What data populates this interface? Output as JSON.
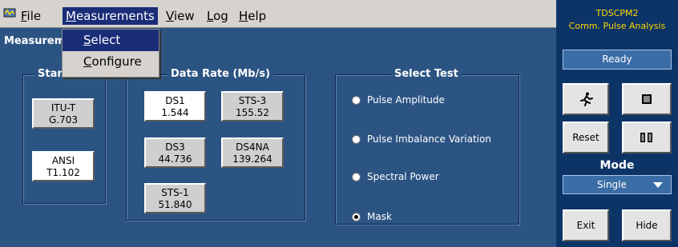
{
  "menubar": {
    "items": [
      {
        "label": "File",
        "key": "F"
      },
      {
        "label": "Measurements",
        "key": "M"
      },
      {
        "label": "View",
        "key": "V"
      },
      {
        "label": "Log",
        "key": "L"
      },
      {
        "label": "Help",
        "key": "H"
      }
    ],
    "dropdown": [
      "Select",
      "Configure"
    ]
  },
  "main": {
    "title": "Measurements",
    "standard_group": {
      "title": "Standard",
      "buttons": [
        {
          "line1": "ITU-T",
          "line2": "G.703"
        },
        {
          "line1": "ANSI",
          "line2": "T1.102"
        }
      ]
    },
    "datarate_group": {
      "title": "Data Rate (Mb/s)",
      "buttons": [
        {
          "line1": "DS1",
          "line2": "1.544"
        },
        {
          "line1": "STS-3",
          "line2": "155.52"
        },
        {
          "line1": "DS3",
          "line2": "44.736"
        },
        {
          "line1": "DS4NA",
          "line2": "139.264"
        },
        {
          "line1": "STS-1",
          "line2": "51.840"
        }
      ]
    },
    "test_group": {
      "title": "Select Test",
      "options": [
        "Pulse Amplitude",
        "Pulse Imbalance Variation",
        "Spectral Power",
        "Mask"
      ]
    }
  },
  "side": {
    "app_name": "TDSCPM2",
    "app_subtitle": "Comm. Pulse Analysis",
    "status": "Ready",
    "reset_label": "Reset",
    "mode_label": "Mode",
    "mode_value": "Single",
    "exit_label": "Exit",
    "hide_label": "Hide"
  }
}
